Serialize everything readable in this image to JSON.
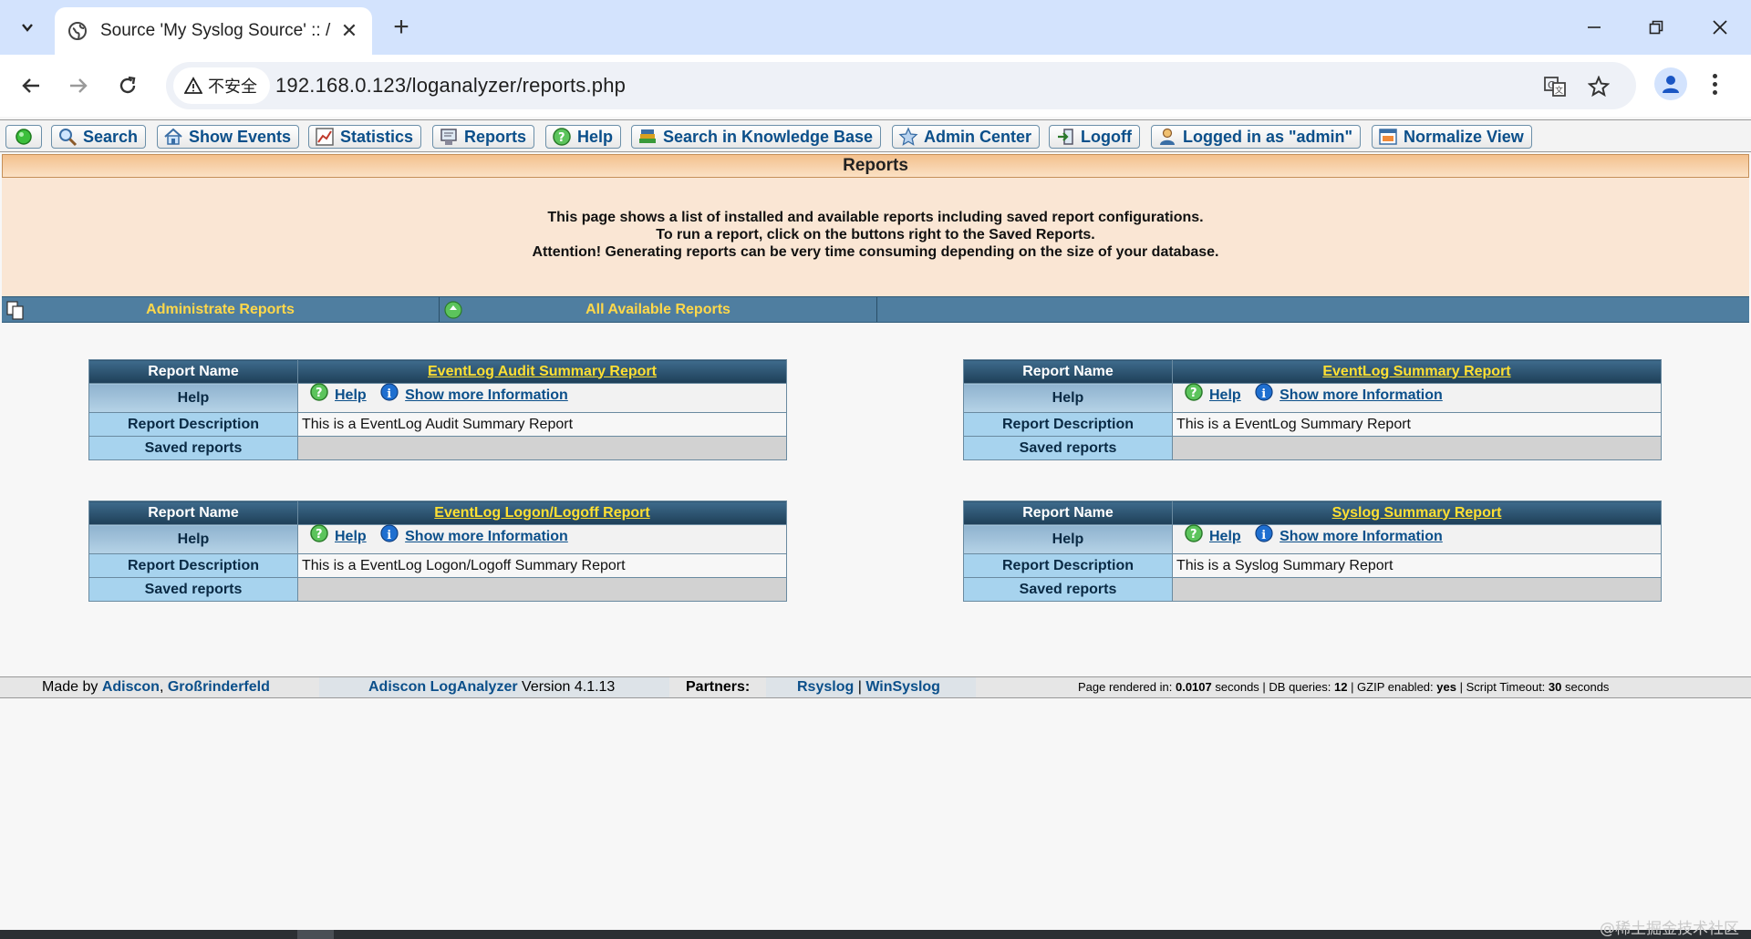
{
  "browser": {
    "tab_title": "Source 'My Syslog Source' :: /",
    "security_label": "不安全",
    "url": "192.168.0.123/loganalyzer/reports.php"
  },
  "menu": [
    {
      "label": "",
      "icon": "status-green-icon"
    },
    {
      "label": "Search",
      "icon": "magnifier-icon"
    },
    {
      "label": "Show Events",
      "icon": "home-icon"
    },
    {
      "label": "Statistics",
      "icon": "chart-icon"
    },
    {
      "label": "Reports",
      "icon": "report-icon"
    },
    {
      "label": "Help",
      "icon": "help-icon"
    },
    {
      "label": "Search in Knowledge Base",
      "icon": "books-icon"
    },
    {
      "label": "Admin Center",
      "icon": "star-icon"
    },
    {
      "label": "Logoff",
      "icon": "logoff-icon"
    },
    {
      "label": "Logged in as \"admin\"",
      "icon": "user-icon"
    },
    {
      "label": "Normalize View",
      "icon": "window-icon"
    }
  ],
  "page_title": "Reports",
  "info": {
    "line1": "This page shows a list of installed and available reports including saved report configurations.",
    "line2": "To run a report, click on the buttons right to the Saved Reports.",
    "line3": "Attention! Generating reports can be very time consuming depending on the size of your database."
  },
  "subnav": {
    "administrate": "Administrate Reports",
    "all_available": "All Available Reports"
  },
  "labels": {
    "report_name": "Report Name",
    "help": "Help",
    "report_description": "Report Description",
    "saved_reports": "Saved reports",
    "help_link": "Help",
    "more_info_link": "Show more Information"
  },
  "reports": [
    {
      "name": "EventLog Audit Summary Report",
      "description": "This is a EventLog Audit Summary Report"
    },
    {
      "name": "EventLog Summary Report",
      "description": "This is a EventLog Summary Report"
    },
    {
      "name": "EventLog Logon/Logoff Report",
      "description": "This is a EventLog Logon/Logoff Summary Report"
    },
    {
      "name": "Syslog Summary Report",
      "description": "This is a Syslog Summary Report"
    }
  ],
  "footer": {
    "made_by": "Made by",
    "adiscon": "Adiscon",
    "comma": ",",
    "grossrinderfeld": "Großrinderfeld",
    "product": "Adiscon LogAnalyzer",
    "version": "Version 4.1.13",
    "partners": "Partners:",
    "rsyslog": "Rsyslog",
    "sep": "|",
    "winsyslog": "WinSyslog",
    "render_label": "Page rendered in:",
    "render_time": "0.0107",
    "seconds": "seconds",
    "db_label": "| DB queries:",
    "db_queries": "12",
    "gzip_label": "| GZIP enabled:",
    "gzip": "yes",
    "timeout_label": "| Script Timeout:",
    "timeout": "30"
  },
  "watermark": "@稀土掘金技术社区"
}
